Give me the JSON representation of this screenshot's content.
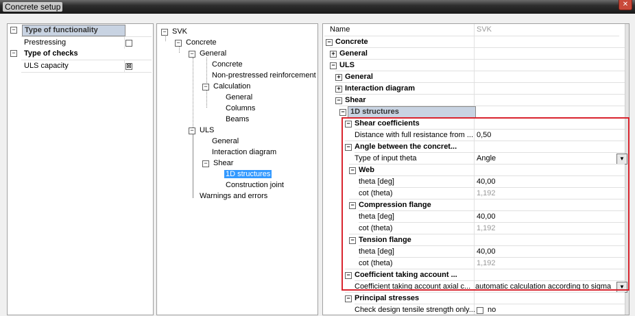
{
  "window": {
    "title": "Concrete setup"
  },
  "functionality": {
    "header": "Type of functionality",
    "prestressing_label": "Prestressing",
    "prestressing_checked": false,
    "checks_header": "Type of checks",
    "uls_label": "ULS capacity",
    "uls_checked": true
  },
  "tree": {
    "root": "SVK",
    "concrete": "Concrete",
    "general": "General",
    "concrete_item": "Concrete",
    "nonprestressed": "Non-prestressed reinforcement",
    "calculation": "Calculation",
    "calc_general": "General",
    "columns": "Columns",
    "beams": "Beams",
    "uls": "ULS",
    "uls_general": "General",
    "interaction": "Interaction diagram",
    "shear": "Shear",
    "structures_1d": "1D structures",
    "construction_joint": "Construction joint",
    "warnings": "Warnings and errors"
  },
  "props": {
    "name_label": "Name",
    "name_value": "SVK",
    "concrete": "Concrete",
    "general1": "General",
    "uls": "ULS",
    "general2": "General",
    "interaction": "Interaction diagram",
    "shear": "Shear",
    "structures_1d": "1D structures",
    "shear_coeff": "Shear coefficients",
    "distance_label": "Distance with full resistance from ...",
    "distance_value": "0,50",
    "angle_between": "Angle between the concret...",
    "type_theta_label": "Type of input theta",
    "type_theta_value": "Angle",
    "web": "Web",
    "web_theta_label": "theta [deg]",
    "web_theta_value": "40,00",
    "web_cot_label": "cot (theta)",
    "web_cot_value": "1,192",
    "compression": "Compression flange",
    "comp_theta_label": "theta [deg]",
    "comp_theta_value": "40,00",
    "comp_cot_label": "cot (theta)",
    "comp_cot_value": "1,192",
    "tension": "Tension flange",
    "ten_theta_label": "theta [deg]",
    "ten_theta_value": "40,00",
    "ten_cot_label": "cot (theta)",
    "ten_cot_value": "1,192",
    "coeff_axial_group": "Coefficient taking account ...",
    "coeff_axial_label": "Coefficient taking account axial c...",
    "coeff_axial_value": "automatic calculation according to sigma_c",
    "principal": "Principal stresses",
    "check_design_label": "Check design tensile strength only...",
    "check_design_value": "no"
  },
  "colors": {
    "highlight_border": "#d9232d",
    "selection": "#3399ff"
  }
}
